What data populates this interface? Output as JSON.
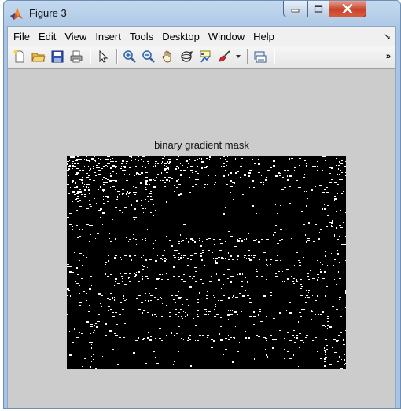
{
  "window": {
    "title": "Figure 3",
    "icon": "matlab-logo-icon"
  },
  "menubar": {
    "items": [
      "File",
      "Edit",
      "View",
      "Insert",
      "Tools",
      "Desktop",
      "Window",
      "Help"
    ],
    "overflow_glyph": "↘"
  },
  "toolbar": {
    "buttons": [
      {
        "name": "new-figure-icon",
        "tooltip": "New Figure"
      },
      {
        "name": "open-file-icon",
        "tooltip": "Open File"
      },
      {
        "name": "save-icon",
        "tooltip": "Save Figure"
      },
      {
        "name": "print-icon",
        "tooltip": "Print Figure"
      },
      {
        "name": "edit-plot-arrow-icon",
        "tooltip": "Edit Plot"
      },
      {
        "name": "zoom-in-icon",
        "tooltip": "Zoom In"
      },
      {
        "name": "zoom-out-icon",
        "tooltip": "Zoom Out"
      },
      {
        "name": "pan-hand-icon",
        "tooltip": "Pan"
      },
      {
        "name": "rotate-3d-icon",
        "tooltip": "Rotate 3D"
      },
      {
        "name": "data-cursor-icon",
        "tooltip": "Data Cursor"
      },
      {
        "name": "brush-icon",
        "tooltip": "Brush/Select Data"
      },
      {
        "name": "link-plot-icon",
        "tooltip": "Link Plot"
      }
    ],
    "overflow_glyph": "»"
  },
  "figure": {
    "axes_title": "binary gradient mask",
    "background": "#cccccc",
    "image_background": "#000000",
    "edge_color": "#ffffff"
  }
}
